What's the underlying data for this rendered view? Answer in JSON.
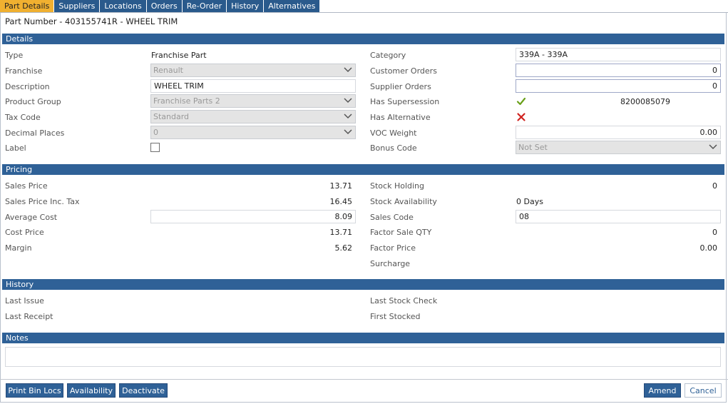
{
  "tabs": [
    "Part Details",
    "Suppliers",
    "Locations",
    "Orders",
    "Re-Order",
    "History",
    "Alternatives"
  ],
  "part_number": "Part Number - 403155741R - WHEEL TRIM",
  "sections": {
    "details": "Details",
    "pricing": "Pricing",
    "history": "History",
    "notes": "Notes"
  },
  "details": {
    "type_label": "Type",
    "type_value": "Franchise Part",
    "franchise_label": "Franchise",
    "franchise_value": "Renault",
    "description_label": "Description",
    "description_value": "WHEEL TRIM",
    "product_group_label": "Product Group",
    "product_group_value": "Franchise Parts 2",
    "tax_code_label": "Tax Code",
    "tax_code_value": "Standard",
    "decimal_places_label": "Decimal Places",
    "decimal_places_value": "0",
    "label_label": "Label",
    "label_checked": false,
    "category_label": "Category",
    "category_value": "339A - 339A",
    "customer_orders_label": "Customer Orders",
    "customer_orders_value": "0",
    "supplier_orders_label": "Supplier Orders",
    "supplier_orders_value": "0",
    "has_supersession_label": "Has Supersession",
    "has_supersession": true,
    "supersession_part": "8200085079",
    "has_alternative_label": "Has Alternative",
    "has_alternative": false,
    "voc_weight_label": "VOC Weight",
    "voc_weight_value": "0.00",
    "bonus_code_label": "Bonus Code",
    "bonus_code_value": "Not Set"
  },
  "pricing": {
    "sales_price_label": "Sales Price",
    "sales_price": "13.71",
    "sales_price_inc_label": "Sales Price Inc. Tax",
    "sales_price_inc": "16.45",
    "average_cost_label": "Average Cost",
    "average_cost": "8.09",
    "cost_price_label": "Cost Price",
    "cost_price": "13.71",
    "margin_label": "Margin",
    "margin": "5.62",
    "stock_holding_label": "Stock Holding",
    "stock_holding": "0",
    "stock_availability_label": "Stock Availability",
    "stock_availability": "0 Days",
    "sales_code_label": "Sales Code",
    "sales_code": "08",
    "factor_sale_qty_label": "Factor Sale QTY",
    "factor_sale_qty": "0",
    "factor_price_label": "Factor Price",
    "factor_price": "0.00",
    "surcharge_label": "Surcharge"
  },
  "history": {
    "last_issue_label": "Last Issue",
    "last_receipt_label": "Last Receipt",
    "last_stock_check_label": "Last Stock Check",
    "first_stocked_label": "First Stocked"
  },
  "buttons": {
    "print_bin_locs": "Print Bin Locs",
    "availability": "Availability",
    "deactivate": "Deactivate",
    "amend": "Amend",
    "cancel": "Cancel"
  },
  "colors": {
    "section_bar": "#2f6197",
    "active_tab": "#f0b030",
    "tick": "#6aa01a",
    "cross": "#d0231f"
  },
  "icons": {
    "supersession": "check-icon",
    "alternative": "cross-icon",
    "dropdown": "chevron-down-icon"
  }
}
